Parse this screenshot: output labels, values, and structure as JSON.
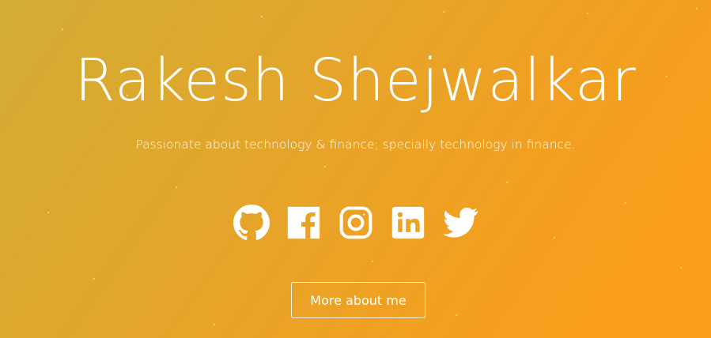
{
  "hero": {
    "name": "Rakesh Shejwalkar",
    "tagline": "Passionate about technology & finance; specially technology in finance.",
    "more_button": "More about me"
  },
  "social_links": [
    {
      "icon": "github-icon"
    },
    {
      "icon": "facebook-icon"
    },
    {
      "icon": "instagram-icon"
    },
    {
      "icon": "linkedin-icon"
    },
    {
      "icon": "twitter-icon"
    }
  ],
  "colors": {
    "gradient_start": "#d2ac35",
    "gradient_end": "#fb9d1a",
    "text": "#ffffff"
  }
}
